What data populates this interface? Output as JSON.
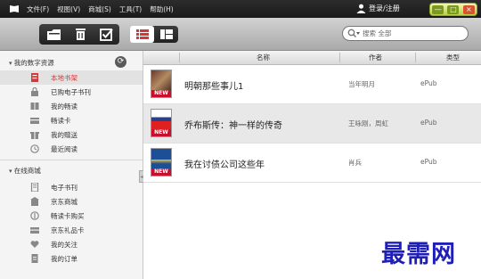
{
  "menu": [
    "文件(F)",
    "视图(V)",
    "商城(S)",
    "工具(T)",
    "帮助(H)"
  ],
  "login_label": "登录/注册",
  "window_buttons": [
    "—",
    "□",
    "×"
  ],
  "search": {
    "placeholder": "搜索 全部"
  },
  "sidebar": {
    "section1": {
      "title": "我的数字资源",
      "items": [
        {
          "label": "本地书架",
          "icon": "bookshelf-icon",
          "active": true
        },
        {
          "label": "已购电子书刊",
          "icon": "lock-icon"
        },
        {
          "label": "我的畅读",
          "icon": "book-icon"
        },
        {
          "label": "畅读卡",
          "icon": "card-icon"
        },
        {
          "label": "我的赠送",
          "icon": "gift-icon"
        },
        {
          "label": "最近阅读",
          "icon": "clock-icon"
        }
      ]
    },
    "section2": {
      "title": "在线商城",
      "items": [
        {
          "label": "电子书刊",
          "icon": "ebook-icon"
        },
        {
          "label": "京东商城",
          "icon": "store-icon"
        },
        {
          "label": "畅读卡购买",
          "icon": "coin-icon"
        },
        {
          "label": "京东礼品卡",
          "icon": "giftcard-icon"
        },
        {
          "label": "我的关注",
          "icon": "heart-icon"
        },
        {
          "label": "我的订单",
          "icon": "order-icon"
        }
      ]
    }
  },
  "table": {
    "headers": {
      "name": "名称",
      "author": "作者",
      "type": "类型"
    },
    "rows": [
      {
        "title": "明朝那些事儿1",
        "author": "当年明月",
        "type": "ePub",
        "badge": "NEW"
      },
      {
        "title": "乔布斯传：神一样的传奇",
        "author": "王咏刚，周虹",
        "type": "ePub",
        "badge": "NEW"
      },
      {
        "title": "我在讨债公司这些年",
        "author": "肖兵",
        "type": "ePub",
        "badge": "NEW"
      }
    ]
  },
  "watermark": "最需网",
  "colors": {
    "accent_red": "#d23a3a",
    "badge_red": "#c8102e",
    "watermark_blue": "#1f1fb8",
    "window_btn_green": "#b9cf46"
  }
}
